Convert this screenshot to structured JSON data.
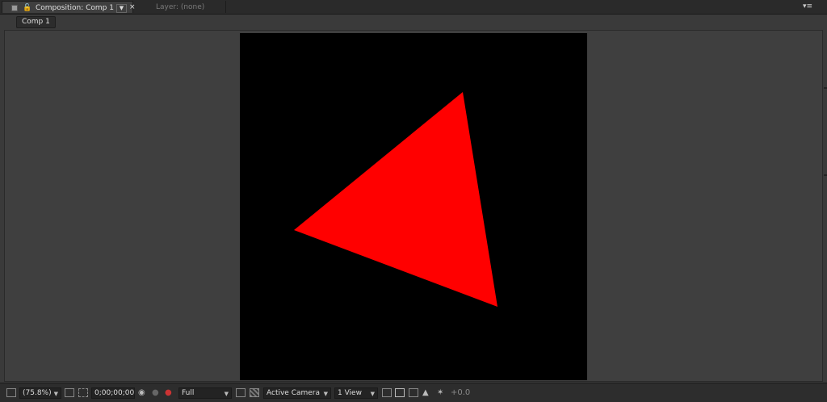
{
  "tabs": {
    "composition": "Composition: Comp 1",
    "layer": "Layer: (none)",
    "close_glyph": "×",
    "dropdown_glyph": "▼",
    "panel_menu_glyph": "▾≡"
  },
  "breadcrumb": {
    "label": "Comp 1"
  },
  "canvas": {
    "background": "#000000",
    "shape_color": "#ff0000"
  },
  "bottombar": {
    "zoom": "(75.8%)",
    "timecode": "0;00;00;00",
    "resolution": "Full",
    "camera": "Active Camera",
    "views": "1 View",
    "exposure": "+0.0"
  }
}
